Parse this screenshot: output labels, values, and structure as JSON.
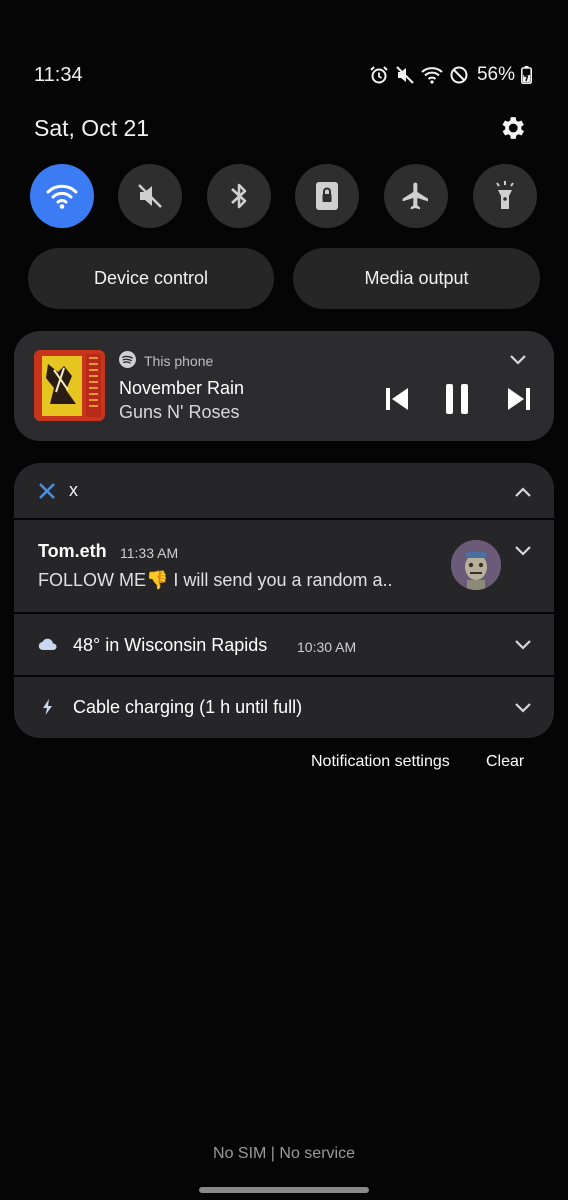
{
  "status_bar": {
    "time": "11:34",
    "battery": "56%"
  },
  "date": "Sat, Oct 21",
  "quick_toggles": [
    {
      "name": "wifi",
      "state": "on"
    },
    {
      "name": "mute",
      "state": "off"
    },
    {
      "name": "bluetooth",
      "state": "off"
    },
    {
      "name": "rotation-lock",
      "state": "off"
    },
    {
      "name": "airplane-mode",
      "state": "off"
    },
    {
      "name": "flashlight",
      "state": "off"
    }
  ],
  "buttons": {
    "device_control": "Device control",
    "media_output": "Media output"
  },
  "media": {
    "source": "This phone",
    "title": "November Rain",
    "artist": "Guns N' Roses"
  },
  "notifications": {
    "x_app": {
      "app_name": "x",
      "sender": "Tom.eth",
      "time": "11:33 AM",
      "message": "FOLLOW ME👎 I will send you a random a.."
    },
    "weather": {
      "text": "48° in Wisconsin Rapids",
      "time": "10:30 AM"
    },
    "charging": {
      "text": "Cable charging (1 h until full)"
    }
  },
  "footer": {
    "notification_settings": "Notification settings",
    "clear": "Clear",
    "carrier": "No SIM | No service"
  },
  "colors": {
    "accent": "#3b7cf4",
    "card": "#262628",
    "tile": "#2e2e2e"
  }
}
